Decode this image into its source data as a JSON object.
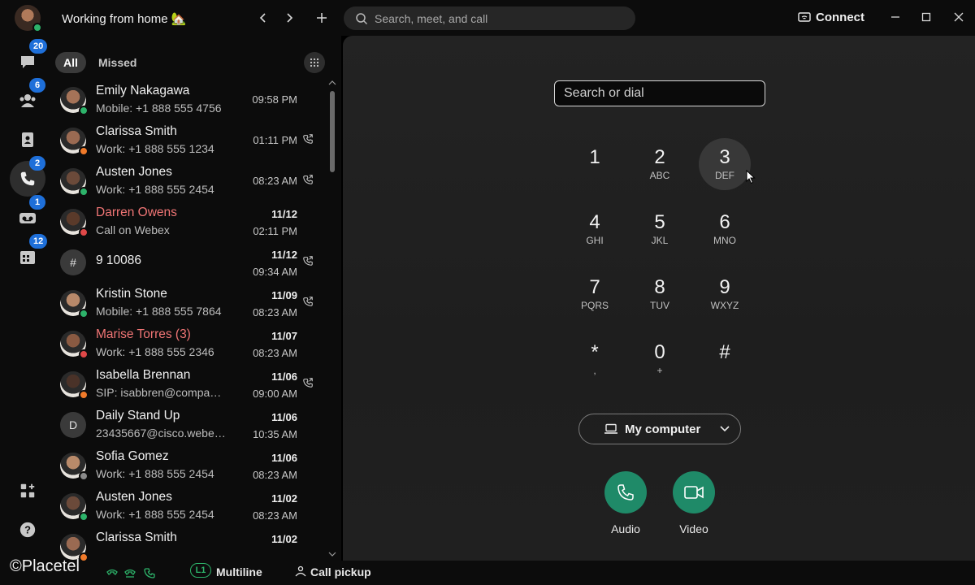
{
  "topbar": {
    "status": "Working from home 🏡",
    "search_placeholder": "Search, meet, and call",
    "connect_label": "Connect"
  },
  "rail": {
    "badges": {
      "messaging": "20",
      "teams": "6",
      "calling": "2",
      "voicemail": "1",
      "meetings": "12"
    }
  },
  "filters": {
    "all": "All",
    "missed": "Missed"
  },
  "calls": [
    {
      "name": "Emily Nakagawa",
      "sub": "Mobile: +1 888 555 4756",
      "date": "",
      "time": "09:58 PM",
      "missed": false,
      "presence": "#2db36a",
      "avatar": "#a57358"
    },
    {
      "name": "Clarissa Smith",
      "sub": "Work: +1 888 555 1234",
      "date": "",
      "time": "01:11 PM",
      "missed": false,
      "presence": "#f07a2a",
      "avatar": "#9a6a52"
    },
    {
      "name": "Austen Jones",
      "sub": "Work: +1 888 555 2454",
      "date": "",
      "time": "08:23 AM",
      "missed": false,
      "presence": "#2db36a",
      "avatar": "#6b4a3a"
    },
    {
      "name": "Darren Owens",
      "sub": "Call on Webex",
      "date": "11/12",
      "time": "02:11 PM",
      "missed": true,
      "presence": "#e04848",
      "avatar": "#5a3a2a"
    },
    {
      "name": "9 10086",
      "sub": "",
      "date": "11/12",
      "time": "09:34 AM",
      "missed": false,
      "presence": "",
      "avatar": "",
      "initial": "#"
    },
    {
      "name": "Kristin Stone",
      "sub": "Mobile: +1 888 555 7864",
      "date": "11/09",
      "time": "08:23 AM",
      "missed": false,
      "presence": "#2db36a",
      "avatar": "#b8896a"
    },
    {
      "name": "Marise Torres (3)",
      "sub": "Work: +1 888 555 2346",
      "date": "11/07",
      "time": "08:23 AM",
      "missed": true,
      "presence": "#e04848",
      "avatar": "#8a5a42"
    },
    {
      "name": "Isabella Brennan",
      "sub": "SIP: isabbren@company...",
      "date": "11/06",
      "time": "09:00 AM",
      "missed": false,
      "presence": "#f07a2a",
      "avatar": "#4a3228"
    },
    {
      "name": "Daily Stand Up",
      "sub": "23435667@cisco.webex...",
      "date": "11/06",
      "time": "10:35 AM",
      "missed": false,
      "presence": "",
      "avatar": "",
      "initial": "D"
    },
    {
      "name": "Sofia Gomez",
      "sub": "Work: +1 888 555 2454",
      "date": "11/06",
      "time": "08:23 AM",
      "missed": false,
      "presence": "#8a8a8a",
      "avatar": "#b88a6a"
    },
    {
      "name": "Austen Jones",
      "sub": "Work: +1 888 555 2454",
      "date": "11/02",
      "time": "08:23 AM",
      "missed": false,
      "presence": "#2db36a",
      "avatar": "#6b4a3a"
    },
    {
      "name": "Clarissa Smith",
      "sub": "",
      "date": "11/02",
      "time": "",
      "missed": false,
      "presence": "#f07a2a",
      "avatar": "#9a6a52"
    }
  ],
  "dialpad": {
    "input_placeholder": "Search or dial",
    "keys": [
      {
        "digit": "1",
        "letters": ""
      },
      {
        "digit": "2",
        "letters": "ABC"
      },
      {
        "digit": "3",
        "letters": "DEF"
      },
      {
        "digit": "4",
        "letters": "GHI"
      },
      {
        "digit": "5",
        "letters": "JKL"
      },
      {
        "digit": "6",
        "letters": "MNO"
      },
      {
        "digit": "7",
        "letters": "PQRS"
      },
      {
        "digit": "8",
        "letters": "TUV"
      },
      {
        "digit": "9",
        "letters": "WXYZ"
      },
      {
        "digit": "*",
        "letters": ","
      },
      {
        "digit": "0",
        "letters": "+"
      },
      {
        "digit": "#",
        "letters": ""
      }
    ],
    "device_label": "My computer",
    "audio_label": "Audio",
    "video_label": "Video"
  },
  "bottombar": {
    "watermark": "©Placetel",
    "line_badge": "L1",
    "multiline_label": "Multiline",
    "call_pickup_label": "Call pickup"
  },
  "colors": {
    "accent_green": "#1f8a68",
    "badge_blue": "#1e6fd9",
    "missed_red": "#f07575"
  }
}
